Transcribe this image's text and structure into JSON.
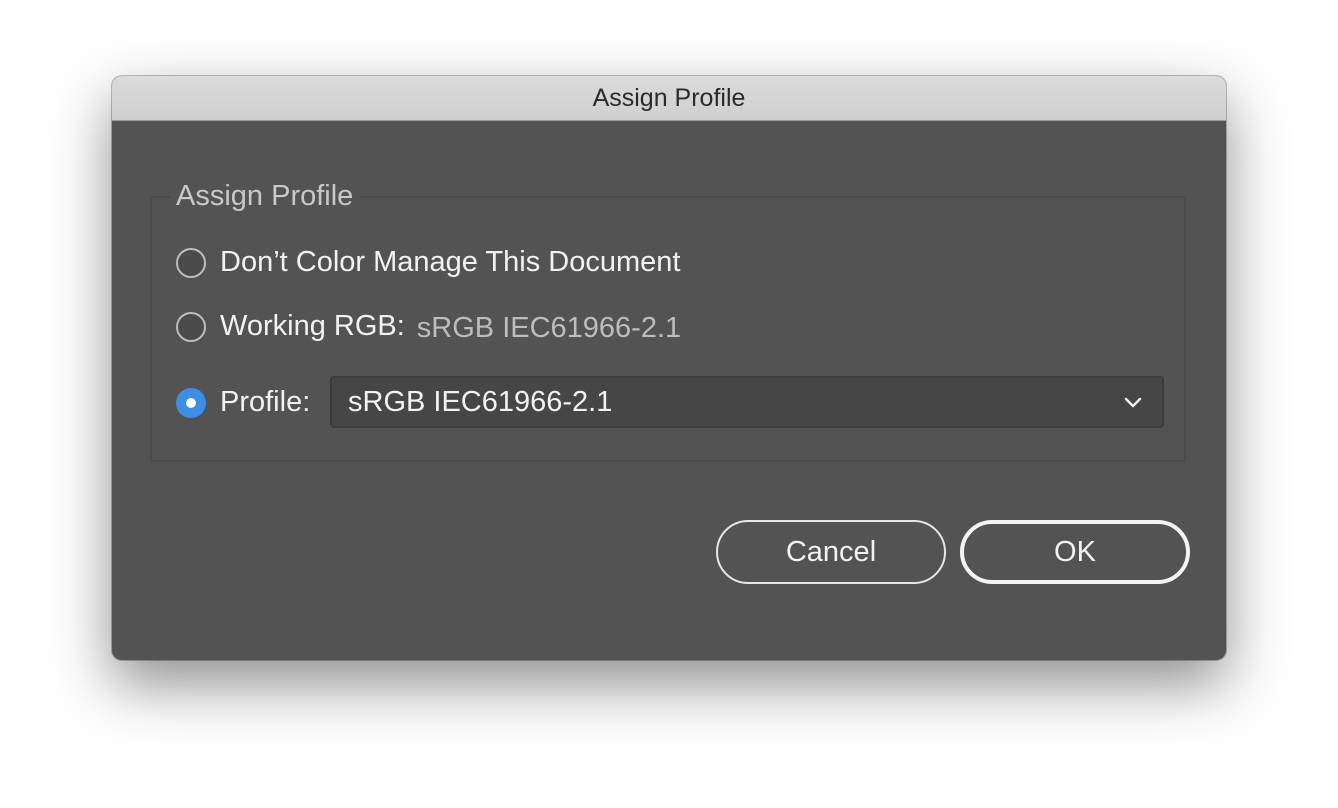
{
  "dialog": {
    "title": "Assign Profile",
    "group_label": "Assign Profile",
    "options": [
      {
        "label": "Don’t Color Manage This Document",
        "checked": false
      },
      {
        "label": "Working RGB:",
        "value": "sRGB IEC61966-2.1",
        "checked": false
      },
      {
        "label": "Profile:",
        "checked": true
      }
    ],
    "profile_select": {
      "selected": "sRGB IEC61966-2.1",
      "icon": "chevron-down-icon"
    },
    "buttons": {
      "cancel": "Cancel",
      "ok": "OK"
    }
  },
  "colors": {
    "dialog_bg": "#535353",
    "titlebar_bg": "#d6d6d6",
    "radio_selected": "#3d8ee6"
  }
}
